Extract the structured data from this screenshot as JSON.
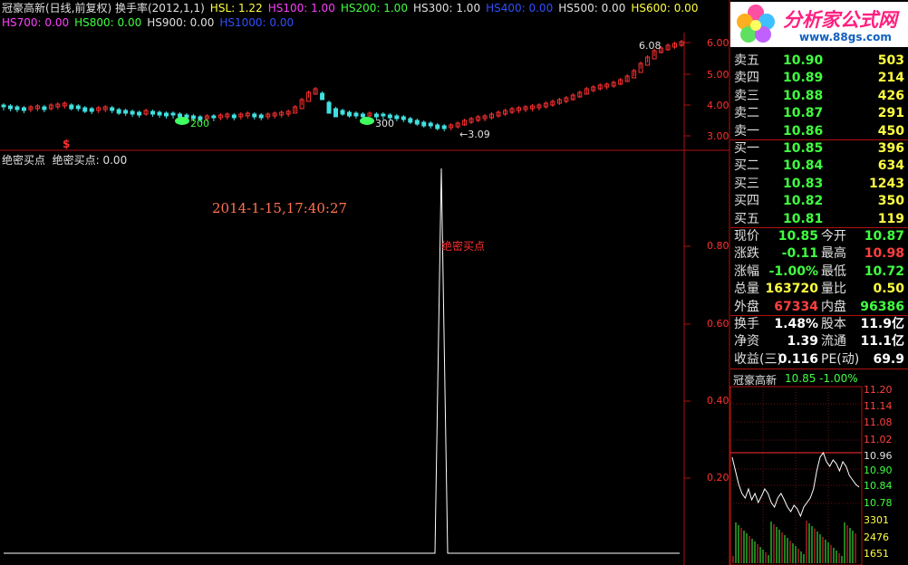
{
  "header": {
    "stock": "冠豪高新(日线,前复权) 换手率(2012,1,1)",
    "indicators_row1": [
      {
        "text": "HSL: 1.22",
        "color": "#ffff40"
      },
      {
        "text": "HS100: 1.00",
        "color": "#ff40ff"
      },
      {
        "text": "HS200: 1.00",
        "color": "#40ff40"
      },
      {
        "text": "HS300: 1.00",
        "color": "#e0e0e0"
      },
      {
        "text": "HS400: 0.00",
        "color": "#3050ff"
      },
      {
        "text": "HS500: 0.00",
        "color": "#e0e0e0"
      },
      {
        "text": "HS600: 0.00",
        "color": "#ffff40"
      }
    ],
    "indicators_row2": [
      {
        "text": "HS700: 0.00",
        "color": "#ff40ff"
      },
      {
        "text": "HS800: 0.00",
        "color": "#40ff40"
      },
      {
        "text": "HS900: 0.00",
        "color": "#e0e0e0"
      },
      {
        "text": "HS1000: 0.00",
        "color": "#3050ff"
      }
    ]
  },
  "logo": {
    "title": "分析家公式网",
    "url": "www.88gs.com"
  },
  "main_chart": {
    "axis_ticks": [
      "6.00",
      "5.00",
      "4.00",
      "3.00"
    ],
    "labels": {
      "high": "6.08",
      "low": "3.09",
      "mark200": "200",
      "mark300": "300",
      "dollar": "$"
    }
  },
  "sub_chart": {
    "title": "绝密买点  绝密买点: 0.00",
    "timestamp": "2014-1-15,17:40:27",
    "signal_label": "绝密买点",
    "axis_ticks": [
      "0.80",
      "0.60",
      "0.40",
      "0.20"
    ]
  },
  "quotes": {
    "sell": [
      {
        "label": "卖五",
        "price": "10.90",
        "vol": "503"
      },
      {
        "label": "卖四",
        "price": "10.89",
        "vol": "214"
      },
      {
        "label": "卖三",
        "price": "10.88",
        "vol": "426"
      },
      {
        "label": "卖二",
        "price": "10.87",
        "vol": "291"
      },
      {
        "label": "卖一",
        "price": "10.86",
        "vol": "450"
      }
    ],
    "buy": [
      {
        "label": "买一",
        "price": "10.85",
        "vol": "396"
      },
      {
        "label": "买二",
        "price": "10.84",
        "vol": "634"
      },
      {
        "label": "买三",
        "price": "10.83",
        "vol": "1243"
      },
      {
        "label": "买四",
        "price": "10.82",
        "vol": "350"
      },
      {
        "label": "买五",
        "price": "10.81",
        "vol": "119"
      }
    ]
  },
  "stats": [
    {
      "l1": "现价",
      "v1": "10.85",
      "c1": "#40ff40",
      "l2": "今开",
      "v2": "10.87",
      "c2": "#40ff40"
    },
    {
      "l1": "涨跌",
      "v1": "-0.11",
      "c1": "#40ff40",
      "l2": "最高",
      "v2": "10.98",
      "c2": "#ff4040"
    },
    {
      "l1": "涨幅",
      "v1": "-1.00%",
      "c1": "#40ff40",
      "l2": "最低",
      "v2": "10.72",
      "c2": "#40ff40"
    },
    {
      "l1": "总量",
      "v1": "163720",
      "c1": "#ffff40",
      "l2": "量比",
      "v2": "0.50",
      "c2": "#ffff40"
    },
    {
      "l1": "外盘",
      "v1": "67334",
      "c1": "#ff4040",
      "l2": "内盘",
      "v2": "96386",
      "c2": "#40ff40"
    },
    {
      "l1": "换手",
      "v1": "1.48%",
      "c1": "#ffffff",
      "l2": "股本",
      "v2": "11.9亿",
      "c2": "#ffffff"
    },
    {
      "l1": "净资",
      "v1": "1.39",
      "c1": "#ffffff",
      "l2": "流通",
      "v2": "11.1亿",
      "c2": "#ffffff"
    },
    {
      "l1": "收益(三)",
      "v1": "0.116",
      "c1": "#ffffff",
      "l2": "PE(动)",
      "v2": "69.9",
      "c2": "#ffffff"
    }
  ],
  "mini": {
    "name": "冠豪高新",
    "quote": "10.85 -1.00%",
    "price_ticks": [
      "11.20",
      "11.14",
      "11.08",
      "11.02",
      "10.96",
      "10.90",
      "10.84",
      "10.78"
    ],
    "vol_ticks": [
      "3301",
      "2476",
      "1651"
    ]
  },
  "chart_data": {
    "type": "line",
    "series": [
      {
        "values_note": "",
        "values": [
          0,
          0,
          0,
          0,
          0,
          0,
          0,
          0,
          0,
          0,
          0,
          0,
          0,
          0,
          0,
          0,
          0,
          0,
          0,
          0,
          0,
          0,
          0,
          0,
          0,
          0,
          0,
          0,
          0,
          0,
          0,
          0,
          0,
          0,
          0,
          0,
          0,
          0,
          0,
          0,
          0,
          0,
          0,
          0,
          0,
          0,
          0,
          0,
          0,
          0,
          0,
          0,
          0,
          0,
          0,
          0,
          0,
          0,
          0,
          0,
          0,
          0,
          0,
          0,
          0,
          0,
          0,
          0,
          0,
          0,
          0,
          0,
          0,
          0,
          0,
          0,
          0,
          0,
          0,
          0,
          1,
          0,
          0,
          0,
          0,
          0,
          0,
          0,
          0,
          0,
          0,
          0,
          0,
          0,
          0,
          0,
          0,
          0,
          0,
          0,
          0,
          0,
          0,
          0,
          0,
          0,
          0,
          0,
          0,
          0,
          0,
          0,
          0,
          0,
          0,
          0,
          0,
          0,
          0,
          0,
          0,
          0,
          0,
          0,
          0,
          0
        ]
      }
    ],
    "ylim": [
      0,
      1
    ]
  }
}
